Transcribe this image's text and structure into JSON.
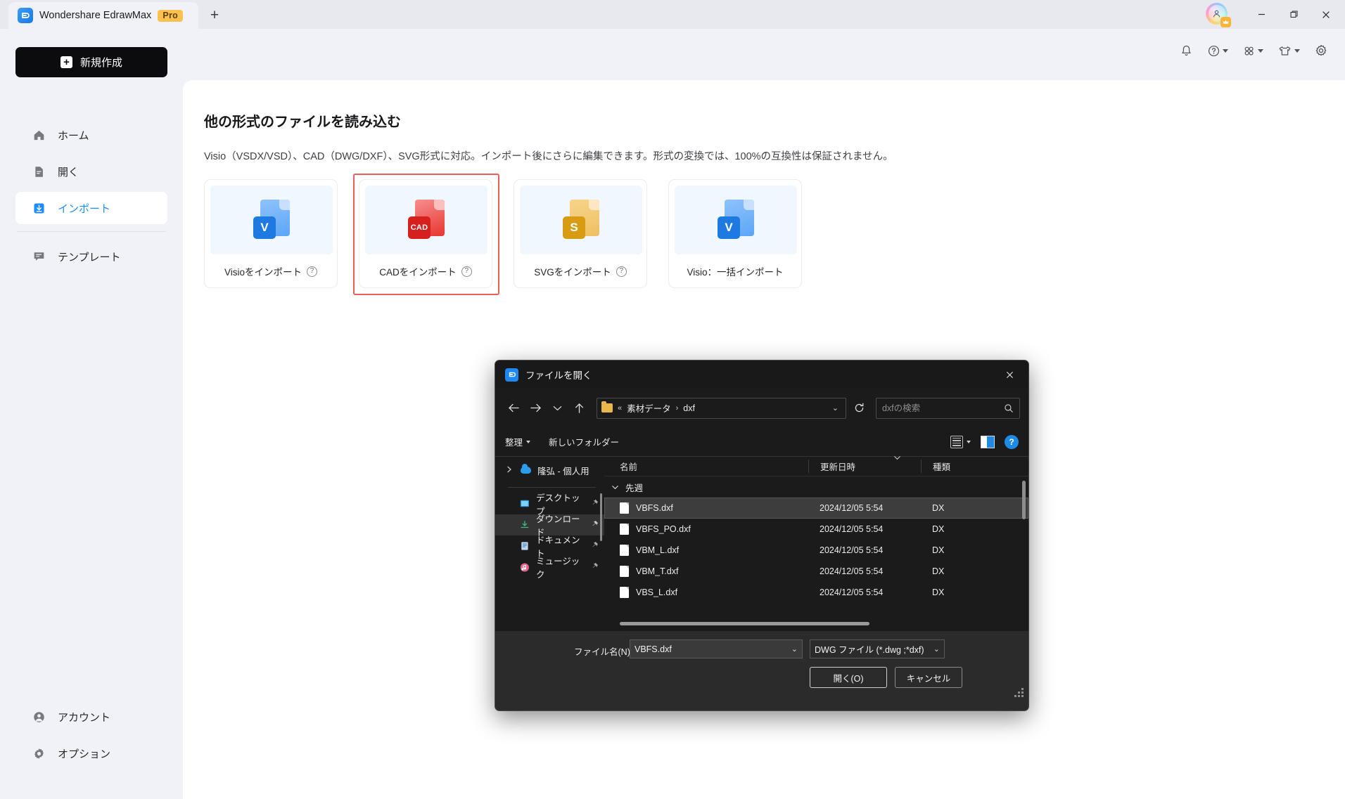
{
  "titlebar": {
    "tab_title": "Wondershare EdrawMax",
    "pro_badge": "Pro",
    "new_tab": "+",
    "minimize": "—",
    "maximize": "❐",
    "close": "✕"
  },
  "sidebar": {
    "new_button": "新規作成",
    "items": [
      {
        "label": "ホーム",
        "icon": "home-icon"
      },
      {
        "label": "開く",
        "icon": "document-icon"
      },
      {
        "label": "インポート",
        "icon": "import-icon"
      },
      {
        "label": "テンプレート",
        "icon": "template-icon"
      }
    ],
    "bottom_items": [
      {
        "label": "アカウント",
        "icon": "account-icon"
      },
      {
        "label": "オプション",
        "icon": "settings-icon"
      }
    ]
  },
  "toolbar": {
    "notification": "bell-icon",
    "help": "help-icon",
    "apps": "apps-grid-icon",
    "theme": "shirt-icon",
    "settings": "gear-icon"
  },
  "main": {
    "title": "他の形式のファイルを読み込む",
    "description": "Visio（VSDX/VSD）、CAD（DWG/DXF）、SVG形式に対応。インポート後にさらに編集できます。形式の変換では、100%の互換性は保証されません。",
    "cards": [
      {
        "label": "Visioをインポート",
        "has_help": true,
        "glyph": "visio-file-icon",
        "badge": "V",
        "selected": false
      },
      {
        "label": "CADをインポート",
        "has_help": true,
        "glyph": "cad-file-icon",
        "badge": "CAD",
        "selected": true
      },
      {
        "label": "SVGをインポート",
        "has_help": true,
        "glyph": "svg-file-icon",
        "badge": "S",
        "selected": false
      },
      {
        "label": "Visio：一括インポート",
        "has_help": false,
        "glyph": "visio-file-icon",
        "badge": "V",
        "selected": false
      }
    ],
    "help_glyph": "?"
  },
  "dialog": {
    "title": "ファイルを開く",
    "close": "✕",
    "nav": {
      "back": "←",
      "forward": "→",
      "recent": "⌄",
      "up": "↑",
      "breadcrumb_prefix": "«",
      "breadcrumb": [
        "素材データ",
        "dxf"
      ],
      "breadcrumb_sep": "›",
      "breadcrumb_caret": "⌄",
      "refresh": "⟳",
      "search_placeholder": "dxfの検索",
      "search_value": "",
      "search_icon": "search-icon"
    },
    "commands": {
      "organize": "整理",
      "new_folder": "新しいフォルダー",
      "view_icon": "list-view-icon",
      "pane_icon": "preview-pane-icon",
      "help_icon": "help-icon",
      "help_glyph": "?"
    },
    "sidebar": {
      "onedrive": "隆弘 - 個人用",
      "items": [
        {
          "label": "デスクトップ",
          "icon": "desktop-icon",
          "pinned": true,
          "selected": false
        },
        {
          "label": "ダウンロード",
          "icon": "download-icon",
          "pinned": true,
          "selected": true
        },
        {
          "label": "ドキュメント",
          "icon": "documents-icon",
          "pinned": true,
          "selected": false
        },
        {
          "label": "ミュージック",
          "icon": "music-icon",
          "pinned": true,
          "selected": false
        }
      ]
    },
    "list": {
      "columns": [
        "名前",
        "更新日時",
        "種類"
      ],
      "group_label": "先週",
      "rows": [
        {
          "name": "VBFS.dxf",
          "date": "2024/12/05 5:54",
          "type": "DX",
          "selected": true
        },
        {
          "name": "VBFS_PO.dxf",
          "date": "2024/12/05 5:54",
          "type": "DX",
          "selected": false
        },
        {
          "name": "VBM_L.dxf",
          "date": "2024/12/05 5:54",
          "type": "DX",
          "selected": false
        },
        {
          "name": "VBM_T.dxf",
          "date": "2024/12/05 5:54",
          "type": "DX",
          "selected": false
        },
        {
          "name": "VBS_L.dxf",
          "date": "2024/12/05 5:54",
          "type": "DX",
          "selected": false
        }
      ]
    },
    "footer": {
      "filename_label": "ファイル名(N):",
      "filename_value": "VBFS.dxf",
      "filetype_value": "DWG ファイル (*.dwg ;*dxf)",
      "open_button": "開く(O)",
      "cancel_button": "キャンセル",
      "dropdown_caret": "⌄"
    }
  },
  "colors": {
    "accent_blue": "#1a8cff",
    "selection_red": "#f05b5b",
    "pro_gold": "#fcc14d",
    "app_bg": "#f1f2f7",
    "dialog_bg": "#2b2b2b"
  }
}
